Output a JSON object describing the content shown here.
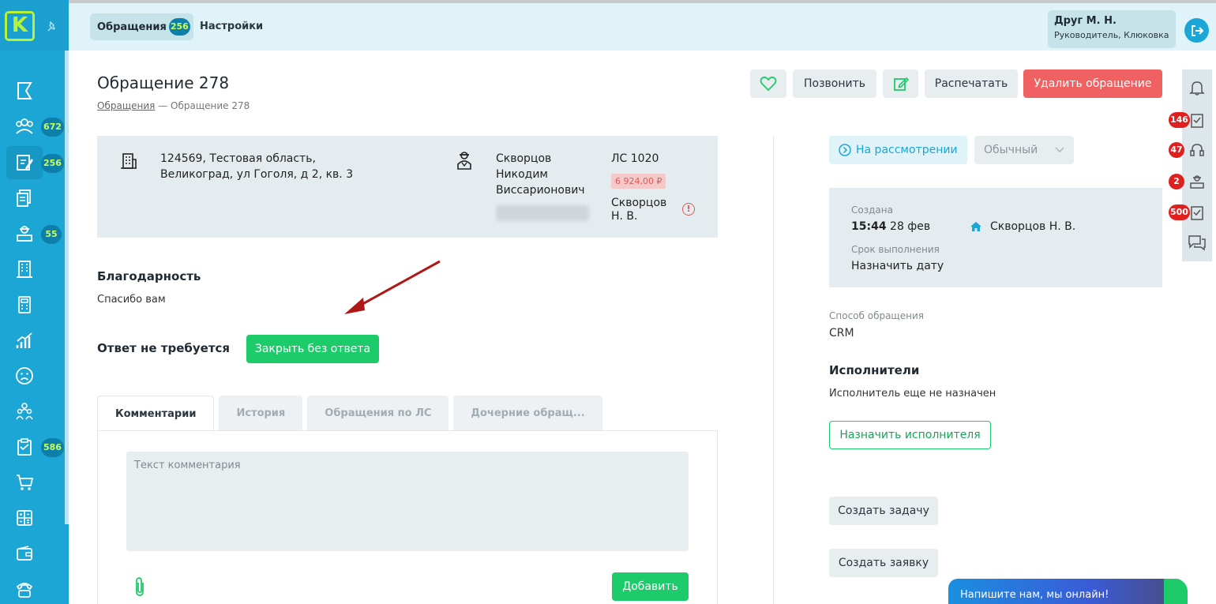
{
  "app": {
    "logo_letter": "K"
  },
  "sidebar": {
    "badges": {
      "residents": "672",
      "appeals": "256",
      "requests": "55",
      "tasks": "586"
    }
  },
  "topbar": {
    "tab_appeals_label": "Обращения",
    "tab_appeals_count": "256",
    "tab_settings_label": "Настройки",
    "user_name": "Друг М. Н.",
    "user_role": "Руководитель, Клюковка"
  },
  "page": {
    "title": "Обращение 278",
    "breadcrumb_link": "Обращения",
    "breadcrumb_sep": " — ",
    "breadcrumb_current": "Обращение 278"
  },
  "actions": {
    "call": "Позвонить",
    "print": "Распечатать",
    "delete": "Удалить обращение"
  },
  "info": {
    "address_line1": "124569, Тестовая область,",
    "address_line2": "Великоград, ул Гоголя, д 2, кв. 3",
    "person_line1": "Скворцов",
    "person_line2": "Никодим",
    "person_line3": "Виссарионович",
    "account": "ЛС 1020",
    "debt": "6 924,00 ₽",
    "owner_line1": "Скворцов",
    "owner_line2": "Н. В.",
    "warn_glyph": "!"
  },
  "appeal": {
    "category": "Благодарность",
    "text": "Спасибо вам",
    "no_reply_label": "Ответ не требуется",
    "close_button": "Закрыть без ответа"
  },
  "tabs": [
    {
      "label": "Комментарии"
    },
    {
      "label": "История"
    },
    {
      "label": "Обращения по ЛС"
    },
    {
      "label": "Дочерние обращ..."
    }
  ],
  "comment": {
    "placeholder": "Текст комментария",
    "add_button": "Добавить"
  },
  "status": {
    "state": "На рассмотрении",
    "priority": "Обычный"
  },
  "meta": {
    "created_label": "Создана",
    "created_time": "15:44",
    "created_date": "28 фев",
    "author": "Скворцов Н. В.",
    "due_label": "Срок выполнения",
    "due_value": "Назначить дату"
  },
  "details": {
    "method_label": "Способ обращения",
    "method_value": "CRM",
    "executors_title": "Исполнители",
    "executors_empty": "Исполнитель еще не назначен",
    "assign_button": "Назначить исполнителя",
    "create_task": "Создать задачу",
    "create_request": "Создать заявку"
  },
  "rail": {
    "badge_tasks": "146",
    "badge_calls": "47",
    "badge_requests": "2",
    "badge_checks": "500"
  },
  "chat": {
    "text": "Напишите нам, мы онлайн!"
  },
  "colors": {
    "sidebar": "#1ba6d6",
    "accent_green": "#1ecb6b",
    "danger": "#f06262",
    "badge_lime": "#c8ff5a",
    "annotation_arrow": "#b01818"
  }
}
